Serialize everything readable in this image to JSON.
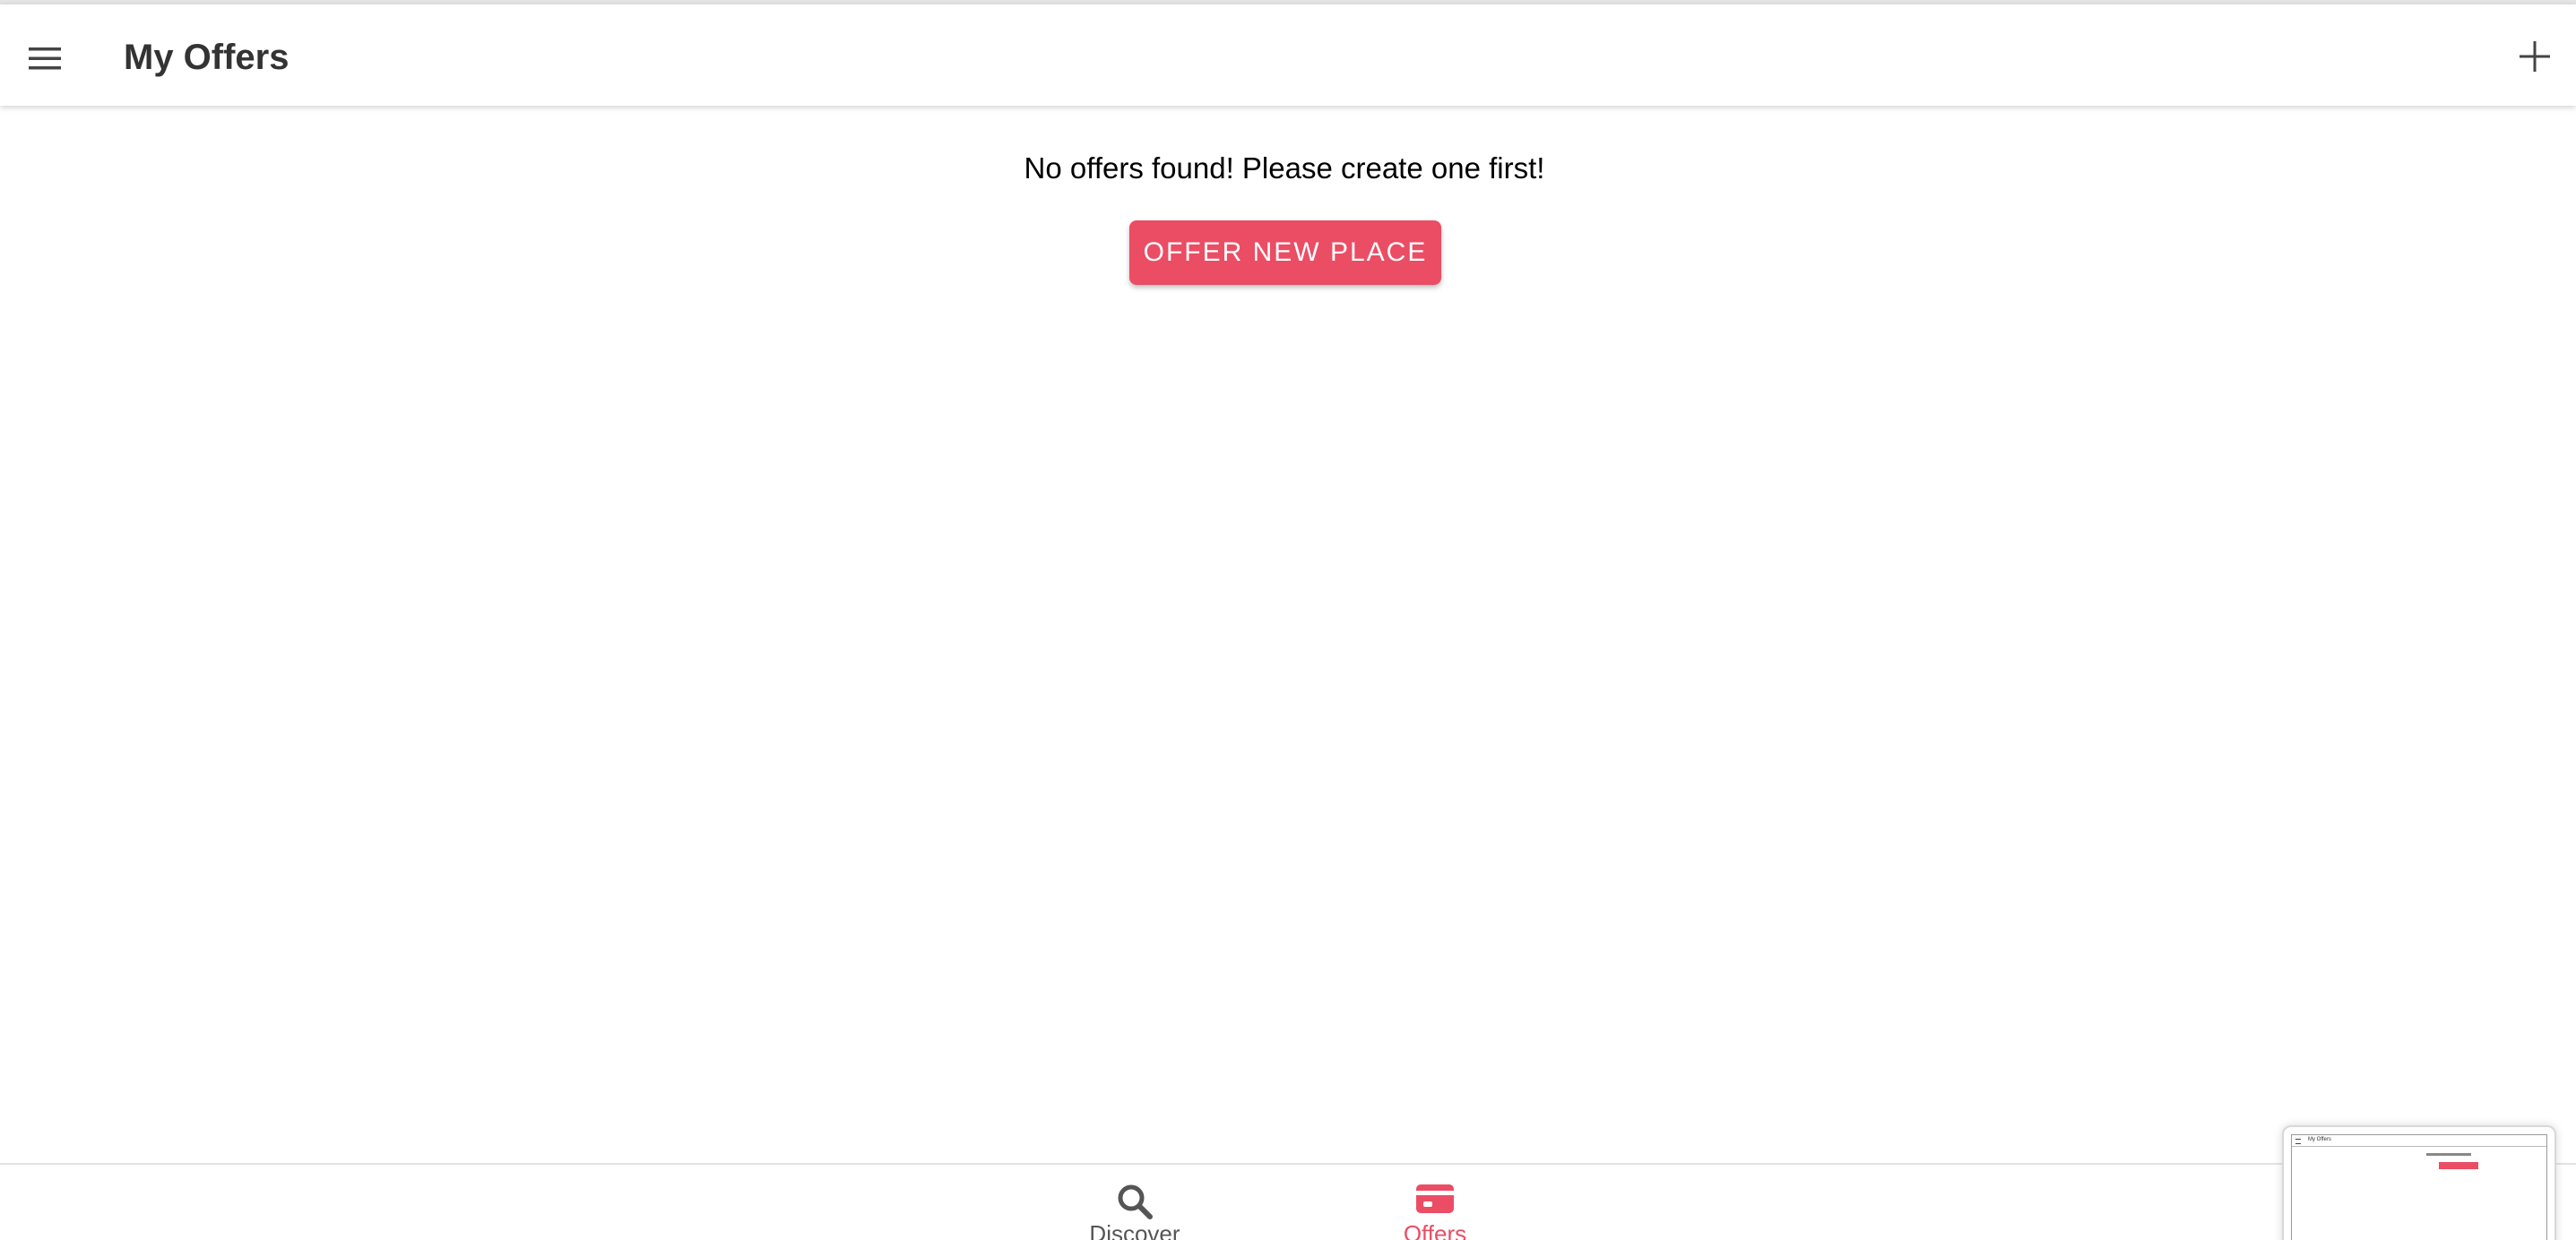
{
  "header": {
    "title": "My Offers",
    "menu_icon": "menu-icon",
    "add_icon": "add-icon"
  },
  "main": {
    "empty_message": "No offers found! Please create one first!",
    "offer_button_label": "OFFER NEW PLACE"
  },
  "tabs": [
    {
      "label": "Discover",
      "icon": "search-icon",
      "selected": false
    },
    {
      "label": "Offers",
      "icon": "card-icon",
      "selected": true
    }
  ],
  "thumbnail": {
    "title": "My Offers"
  },
  "colors": {
    "accent": "#eb4d64",
    "title_text": "#333333",
    "tab_inactive": "#555555"
  }
}
